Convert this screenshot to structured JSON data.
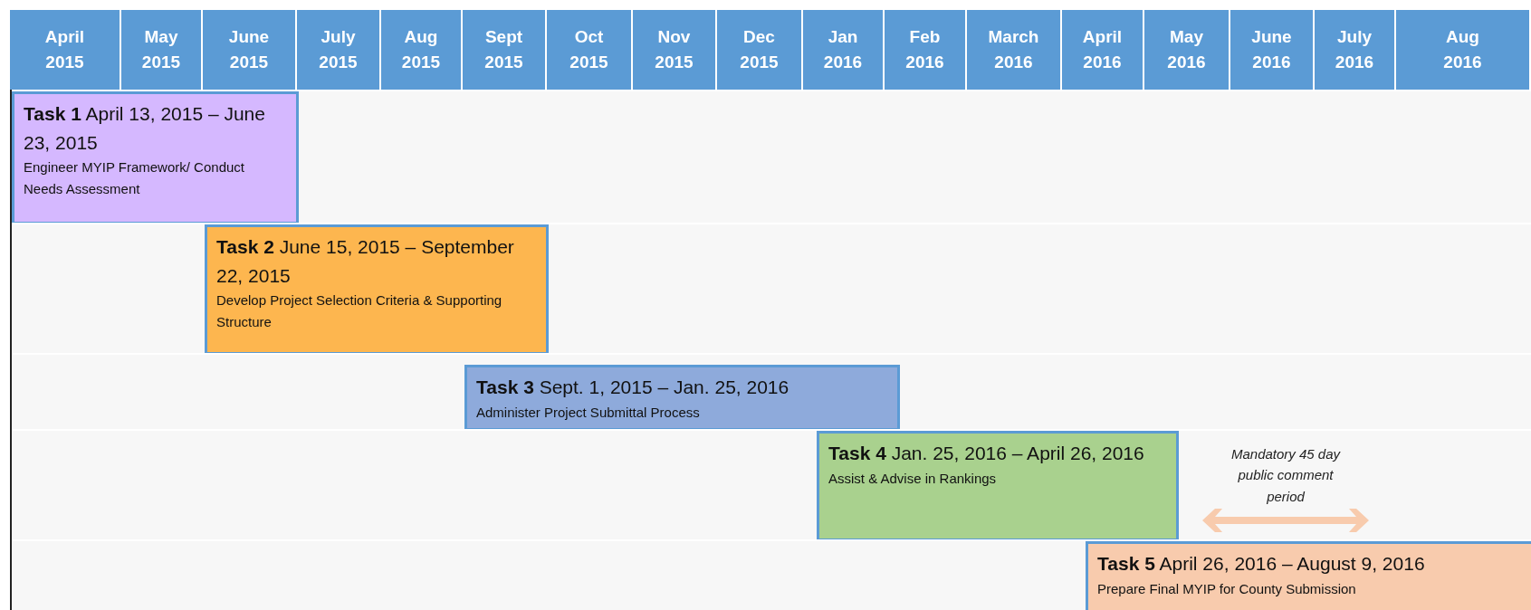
{
  "header": {
    "months": [
      {
        "month": "April",
        "year": "2015"
      },
      {
        "month": "May",
        "year": "2015"
      },
      {
        "month": "June",
        "year": "2015"
      },
      {
        "month": "July",
        "year": "2015"
      },
      {
        "month": "Aug",
        "year": "2015"
      },
      {
        "month": "Sept",
        "year": "2015"
      },
      {
        "month": "Oct",
        "year": "2015"
      },
      {
        "month": "Nov",
        "year": "2015"
      },
      {
        "month": "Dec",
        "year": "2015"
      },
      {
        "month": "Jan",
        "year": "2016"
      },
      {
        "month": "Feb",
        "year": "2016"
      },
      {
        "month": "March",
        "year": "2016"
      },
      {
        "month": "April",
        "year": "2016"
      },
      {
        "month": "May",
        "year": "2016"
      },
      {
        "month": "June",
        "year": "2016"
      },
      {
        "month": "July",
        "year": "2016"
      },
      {
        "month": "Aug",
        "year": "2016"
      }
    ]
  },
  "tasks": [
    {
      "label": "Task 1",
      "dates": "April 13, 2015 – June 23, 2015",
      "description": "Engineer MYIP Framework/ Conduct Needs Assessment",
      "color": "#d5b8ff"
    },
    {
      "label": "Task 2",
      "dates": "June 15, 2015 – September 22, 2015",
      "description": "Develop Project Selection Criteria & Supporting Structure",
      "color": "#fdb64f"
    },
    {
      "label": "Task 3",
      "dates": "Sept. 1, 2015 – Jan. 25, 2016",
      "description": "Administer Project Submittal Process",
      "color": "#8eaadb"
    },
    {
      "label": "Task 4",
      "dates": "Jan. 25, 2016 – April 26, 2016",
      "description": "Assist & Advise in Rankings",
      "color": "#a9d18e"
    },
    {
      "label": "Task 5",
      "dates": "April 26, 2016 – August 9, 2016",
      "description": "Prepare Final MYIP for County Submission",
      "color": "#f8cbad"
    }
  ],
  "note": {
    "text": "Mandatory 45 day public comment period"
  }
}
